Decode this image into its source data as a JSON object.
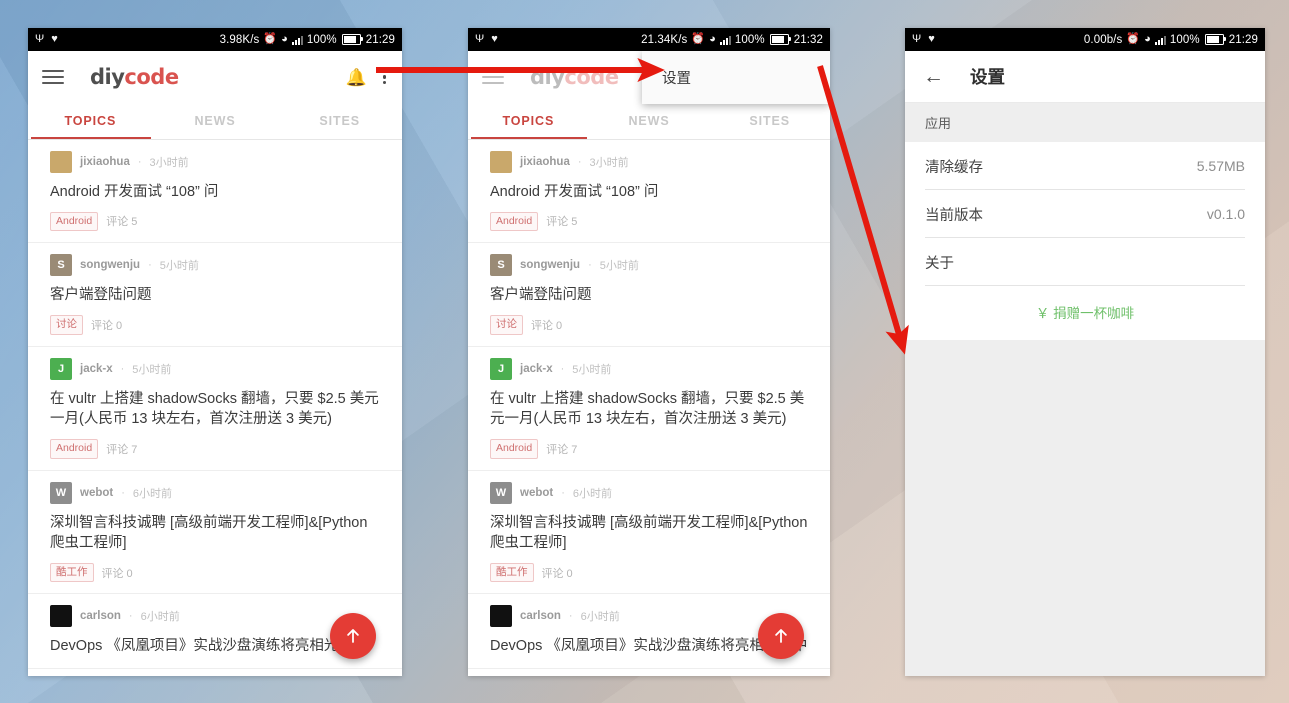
{
  "panels": {
    "phone1": {
      "status": {
        "usb_icon": "usb-icon",
        "shield_icon": "shield-icon",
        "speed": "3.98K/s",
        "alarm_icon": "alarm-icon",
        "wifi_icon": "wifi-icon",
        "signal_icon": "signal-icon",
        "battery_pct": "100%",
        "time": "21:29"
      },
      "appbar": {
        "menu_icon": "hamburger-icon",
        "brand_first": "diy",
        "brand_second": "code",
        "bell_icon": "bell-icon",
        "overflow_icon": "overflow-menu-icon"
      },
      "tabs": [
        {
          "label": "TOPICS",
          "active": true
        },
        {
          "label": "NEWS",
          "active": false
        },
        {
          "label": "SITES",
          "active": false
        }
      ],
      "fab": {
        "icon": "arrow-up-icon"
      }
    },
    "phone2": {
      "status": {
        "usb_icon": "usb-icon",
        "shield_icon": "shield-icon",
        "speed": "21.34K/s",
        "alarm_icon": "alarm-icon",
        "wifi_icon": "wifi-icon",
        "signal_icon": "signal-icon",
        "battery_pct": "100%",
        "time": "21:32"
      },
      "appbar": {
        "menu_icon": "hamburger-icon",
        "brand_first": "diy",
        "brand_second": "code"
      },
      "popup": {
        "items": [
          "设置"
        ]
      },
      "tabs": [
        {
          "label": "TOPICS",
          "active": true
        },
        {
          "label": "NEWS",
          "active": false
        },
        {
          "label": "SITES",
          "active": false
        }
      ],
      "fab": {
        "icon": "arrow-up-icon"
      }
    },
    "phone3": {
      "status": {
        "usb_icon": "usb-icon",
        "shield_icon": "shield-icon",
        "speed": "0.00b/s",
        "alarm_icon": "alarm-icon",
        "wifi_icon": "wifi-icon",
        "signal_icon": "signal-icon",
        "battery_pct": "100%",
        "time": "21:29"
      },
      "appbar": {
        "back_icon": "back-arrow-icon",
        "title": "设置"
      },
      "section_header": "应用",
      "rows": [
        {
          "label": "清除缓存",
          "value": "5.57MB"
        },
        {
          "label": "当前版本",
          "value": "v0.1.0"
        },
        {
          "label": "关于",
          "value": ""
        }
      ],
      "donate": "￥ 捐赠一杯咖啡"
    }
  },
  "topics": [
    {
      "user": "jixiaohua",
      "ago": "3小时前",
      "avatar_letter": "",
      "avatar_color": "#c9a86b",
      "title": "Android 开发面试 “108” 问",
      "tag": "Android",
      "comments": "评论 5"
    },
    {
      "user": "songwenju",
      "ago": "5小时前",
      "avatar_letter": "S",
      "avatar_color": "#9a8b76",
      "title": "客户端登陆问题",
      "tag": "讨论",
      "comments": "评论 0"
    },
    {
      "user": "jack-x",
      "ago": "5小时前",
      "avatar_letter": "J",
      "avatar_color": "#4caf50",
      "title": "在 vultr 上搭建 shadowSocks 翻墙，只要 $2.5 美元一月(人民币 13 块左右，首次注册送 3 美元)",
      "tag": "Android",
      "comments": "评论 7"
    },
    {
      "user": "webot",
      "ago": "6小时前",
      "avatar_letter": "W",
      "avatar_color": "#8d8d8d",
      "title": "深圳智言科技诚聘 [高级前端开发工程师]&[Python 爬虫工程师]",
      "tag": "酷工作",
      "comments": "评论 0"
    },
    {
      "user": "carlson",
      "ago": "6小时前",
      "avatar_letter": "",
      "avatar_color": "#111111",
      "title": "DevOps 《凤凰项目》实战沙盘演练将亮相光环中",
      "tag": "",
      "comments": ""
    }
  ],
  "annotations": {
    "arrow1": {
      "name": "arrow-overflow-to-menu",
      "color": "#e51a0f"
    },
    "arrow2": {
      "name": "arrow-menu-to-settings",
      "color": "#e51a0f"
    }
  },
  "theme": {
    "accent_red": "#c9453f",
    "fab_red": "#e43c35",
    "green": "#6fc06a",
    "arrow_red": "#e51a0f"
  }
}
